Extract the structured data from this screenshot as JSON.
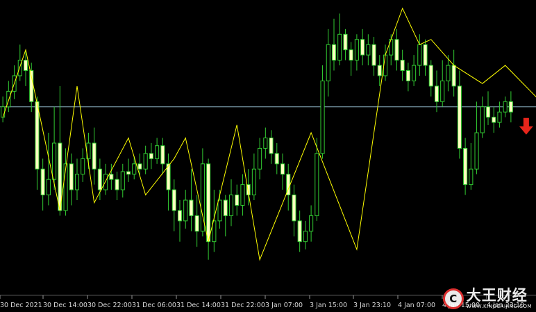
{
  "chart_data": {
    "type": "candlestick",
    "colors": {
      "background": "#000000",
      "candle_outline": "#32CD32",
      "bull_body": "#000000",
      "bear_body": "#FFFFC0",
      "zigzag": "#FFFF00",
      "price_line": "#8FB8C8",
      "sell_arrow": "#E8251B",
      "axis_text": "#D8D8D8"
    },
    "x_tick_labels": [
      "30 Dec 2021",
      "30 Dec 14:00",
      "30 Dec 22:00",
      "31 Dec 06:00",
      "31 Dec 14:00",
      "31 Dec 22:00",
      "3 Jan 07:00",
      "3 Jan 15:00",
      "3 Jan 23:10",
      "4 Jan 07:00",
      "4 Jan 15:00",
      "4 Jan 23:10"
    ],
    "y_axis_visible": false,
    "grid": false,
    "current_price_line": 0.62,
    "sell_signal": "down-arrow-after-last-bar",
    "zigzag_points": [
      [
        0,
        0.58
      ],
      [
        4,
        0.84
      ],
      [
        10,
        0.22
      ],
      [
        13,
        0.7
      ],
      [
        16,
        0.25
      ],
      [
        22,
        0.5
      ],
      [
        25,
        0.28
      ],
      [
        30,
        0.42
      ],
      [
        32,
        0.5
      ],
      [
        36,
        0.1
      ],
      [
        41,
        0.55
      ],
      [
        45,
        0.03
      ],
      [
        54,
        0.52
      ],
      [
        62,
        0.07
      ],
      [
        67,
        0.82
      ],
      [
        70,
        1.0
      ],
      [
        73,
        0.86
      ],
      [
        75,
        0.88
      ],
      [
        79,
        0.78
      ],
      [
        84,
        0.71
      ],
      [
        88,
        0.78
      ],
      [
        92,
        0.69
      ],
      [
        96,
        0.6
      ],
      [
        99,
        0.68
      ],
      [
        101,
        0.82
      ],
      [
        106,
        0.35
      ],
      [
        113,
        0.68
      ],
      [
        117,
        0.55
      ],
      [
        122,
        0.55
      ]
    ],
    "candles": [
      [
        0.58,
        0.62,
        0.66,
        0.56
      ],
      [
        0.62,
        0.68,
        0.72,
        0.6
      ],
      [
        0.68,
        0.74,
        0.78,
        0.65
      ],
      [
        0.74,
        0.8,
        0.86,
        0.72
      ],
      [
        0.8,
        0.76,
        0.84,
        0.7
      ],
      [
        0.76,
        0.64,
        0.79,
        0.6
      ],
      [
        0.64,
        0.38,
        0.66,
        0.3
      ],
      [
        0.38,
        0.28,
        0.42,
        0.22
      ],
      [
        0.28,
        0.34,
        0.52,
        0.24
      ],
      [
        0.34,
        0.48,
        0.62,
        0.3
      ],
      [
        0.48,
        0.22,
        0.7,
        0.2
      ],
      [
        0.22,
        0.4,
        0.46,
        0.2
      ],
      [
        0.4,
        0.3,
        0.44,
        0.24
      ],
      [
        0.3,
        0.36,
        0.42,
        0.26
      ],
      [
        0.36,
        0.42,
        0.46,
        0.33
      ],
      [
        0.42,
        0.48,
        0.52,
        0.38
      ],
      [
        0.48,
        0.38,
        0.54,
        0.32
      ],
      [
        0.38,
        0.3,
        0.42,
        0.26
      ],
      [
        0.3,
        0.36,
        0.4,
        0.28
      ],
      [
        0.36,
        0.34,
        0.4,
        0.3
      ],
      [
        0.34,
        0.3,
        0.37,
        0.26
      ],
      [
        0.3,
        0.37,
        0.4,
        0.27
      ],
      [
        0.37,
        0.36,
        0.42,
        0.33
      ],
      [
        0.36,
        0.4,
        0.43,
        0.34
      ],
      [
        0.4,
        0.38,
        0.44,
        0.35
      ],
      [
        0.38,
        0.44,
        0.47,
        0.36
      ],
      [
        0.44,
        0.42,
        0.48,
        0.38
      ],
      [
        0.42,
        0.47,
        0.5,
        0.4
      ],
      [
        0.47,
        0.4,
        0.5,
        0.36
      ],
      [
        0.4,
        0.3,
        0.44,
        0.22
      ],
      [
        0.3,
        0.22,
        0.34,
        0.14
      ],
      [
        0.22,
        0.18,
        0.26,
        0.1
      ],
      [
        0.18,
        0.26,
        0.3,
        0.15
      ],
      [
        0.26,
        0.2,
        0.38,
        0.14
      ],
      [
        0.2,
        0.14,
        0.28,
        0.08
      ],
      [
        0.14,
        0.4,
        0.46,
        0.12
      ],
      [
        0.4,
        0.1,
        0.42,
        0.03
      ],
      [
        0.1,
        0.18,
        0.3,
        0.06
      ],
      [
        0.18,
        0.26,
        0.3,
        0.15
      ],
      [
        0.26,
        0.2,
        0.28,
        0.12
      ],
      [
        0.2,
        0.28,
        0.34,
        0.16
      ],
      [
        0.28,
        0.24,
        0.32,
        0.2
      ],
      [
        0.24,
        0.32,
        0.36,
        0.2
      ],
      [
        0.32,
        0.28,
        0.38,
        0.24
      ],
      [
        0.28,
        0.38,
        0.44,
        0.26
      ],
      [
        0.38,
        0.46,
        0.5,
        0.34
      ],
      [
        0.46,
        0.5,
        0.54,
        0.42
      ],
      [
        0.5,
        0.44,
        0.53,
        0.4
      ],
      [
        0.44,
        0.4,
        0.48,
        0.36
      ],
      [
        0.4,
        0.36,
        0.44,
        0.3
      ],
      [
        0.36,
        0.28,
        0.4,
        0.22
      ],
      [
        0.28,
        0.18,
        0.32,
        0.12
      ],
      [
        0.18,
        0.1,
        0.22,
        0.06
      ],
      [
        0.1,
        0.14,
        0.18,
        0.07
      ],
      [
        0.14,
        0.2,
        0.24,
        0.1
      ],
      [
        0.2,
        0.44,
        0.5,
        0.18
      ],
      [
        0.44,
        0.72,
        0.78,
        0.42
      ],
      [
        0.72,
        0.86,
        0.92,
        0.66
      ],
      [
        0.86,
        0.8,
        0.96,
        0.76
      ],
      [
        0.8,
        0.9,
        0.98,
        0.78
      ],
      [
        0.9,
        0.84,
        0.92,
        0.8
      ],
      [
        0.84,
        0.8,
        0.87,
        0.74
      ],
      [
        0.8,
        0.88,
        0.9,
        0.76
      ],
      [
        0.88,
        0.82,
        0.92,
        0.78
      ],
      [
        0.82,
        0.86,
        0.9,
        0.78
      ],
      [
        0.86,
        0.78,
        0.89,
        0.74
      ],
      [
        0.78,
        0.74,
        0.82,
        0.7
      ],
      [
        0.74,
        0.82,
        0.86,
        0.72
      ],
      [
        0.82,
        0.88,
        0.9,
        0.78
      ],
      [
        0.88,
        0.8,
        0.92,
        0.76
      ],
      [
        0.8,
        0.76,
        0.84,
        0.72
      ],
      [
        0.76,
        0.72,
        0.79,
        0.68
      ],
      [
        0.72,
        0.78,
        0.82,
        0.7
      ],
      [
        0.78,
        0.86,
        0.9,
        0.74
      ],
      [
        0.86,
        0.78,
        0.88,
        0.74
      ],
      [
        0.78,
        0.7,
        0.8,
        0.66
      ],
      [
        0.7,
        0.64,
        0.76,
        0.6
      ],
      [
        0.64,
        0.72,
        0.8,
        0.62
      ],
      [
        0.72,
        0.78,
        0.82,
        0.68
      ],
      [
        0.78,
        0.7,
        0.84,
        0.66
      ],
      [
        0.7,
        0.46,
        0.76,
        0.42
      ],
      [
        0.46,
        0.32,
        0.5,
        0.28
      ],
      [
        0.32,
        0.38,
        0.48,
        0.3
      ],
      [
        0.38,
        0.52,
        0.64,
        0.36
      ],
      [
        0.52,
        0.62,
        0.66,
        0.5
      ],
      [
        0.62,
        0.58,
        0.68,
        0.55
      ],
      [
        0.58,
        0.56,
        0.62,
        0.52
      ],
      [
        0.56,
        0.6,
        0.64,
        0.54
      ],
      [
        0.6,
        0.64,
        0.66,
        0.58
      ],
      [
        0.64,
        0.6,
        0.68,
        0.56
      ]
    ]
  },
  "watermark": {
    "brand_mark": "C",
    "brand_text": "大王财经",
    "brand_url": "WWW.KINGCAIJING.COM"
  }
}
